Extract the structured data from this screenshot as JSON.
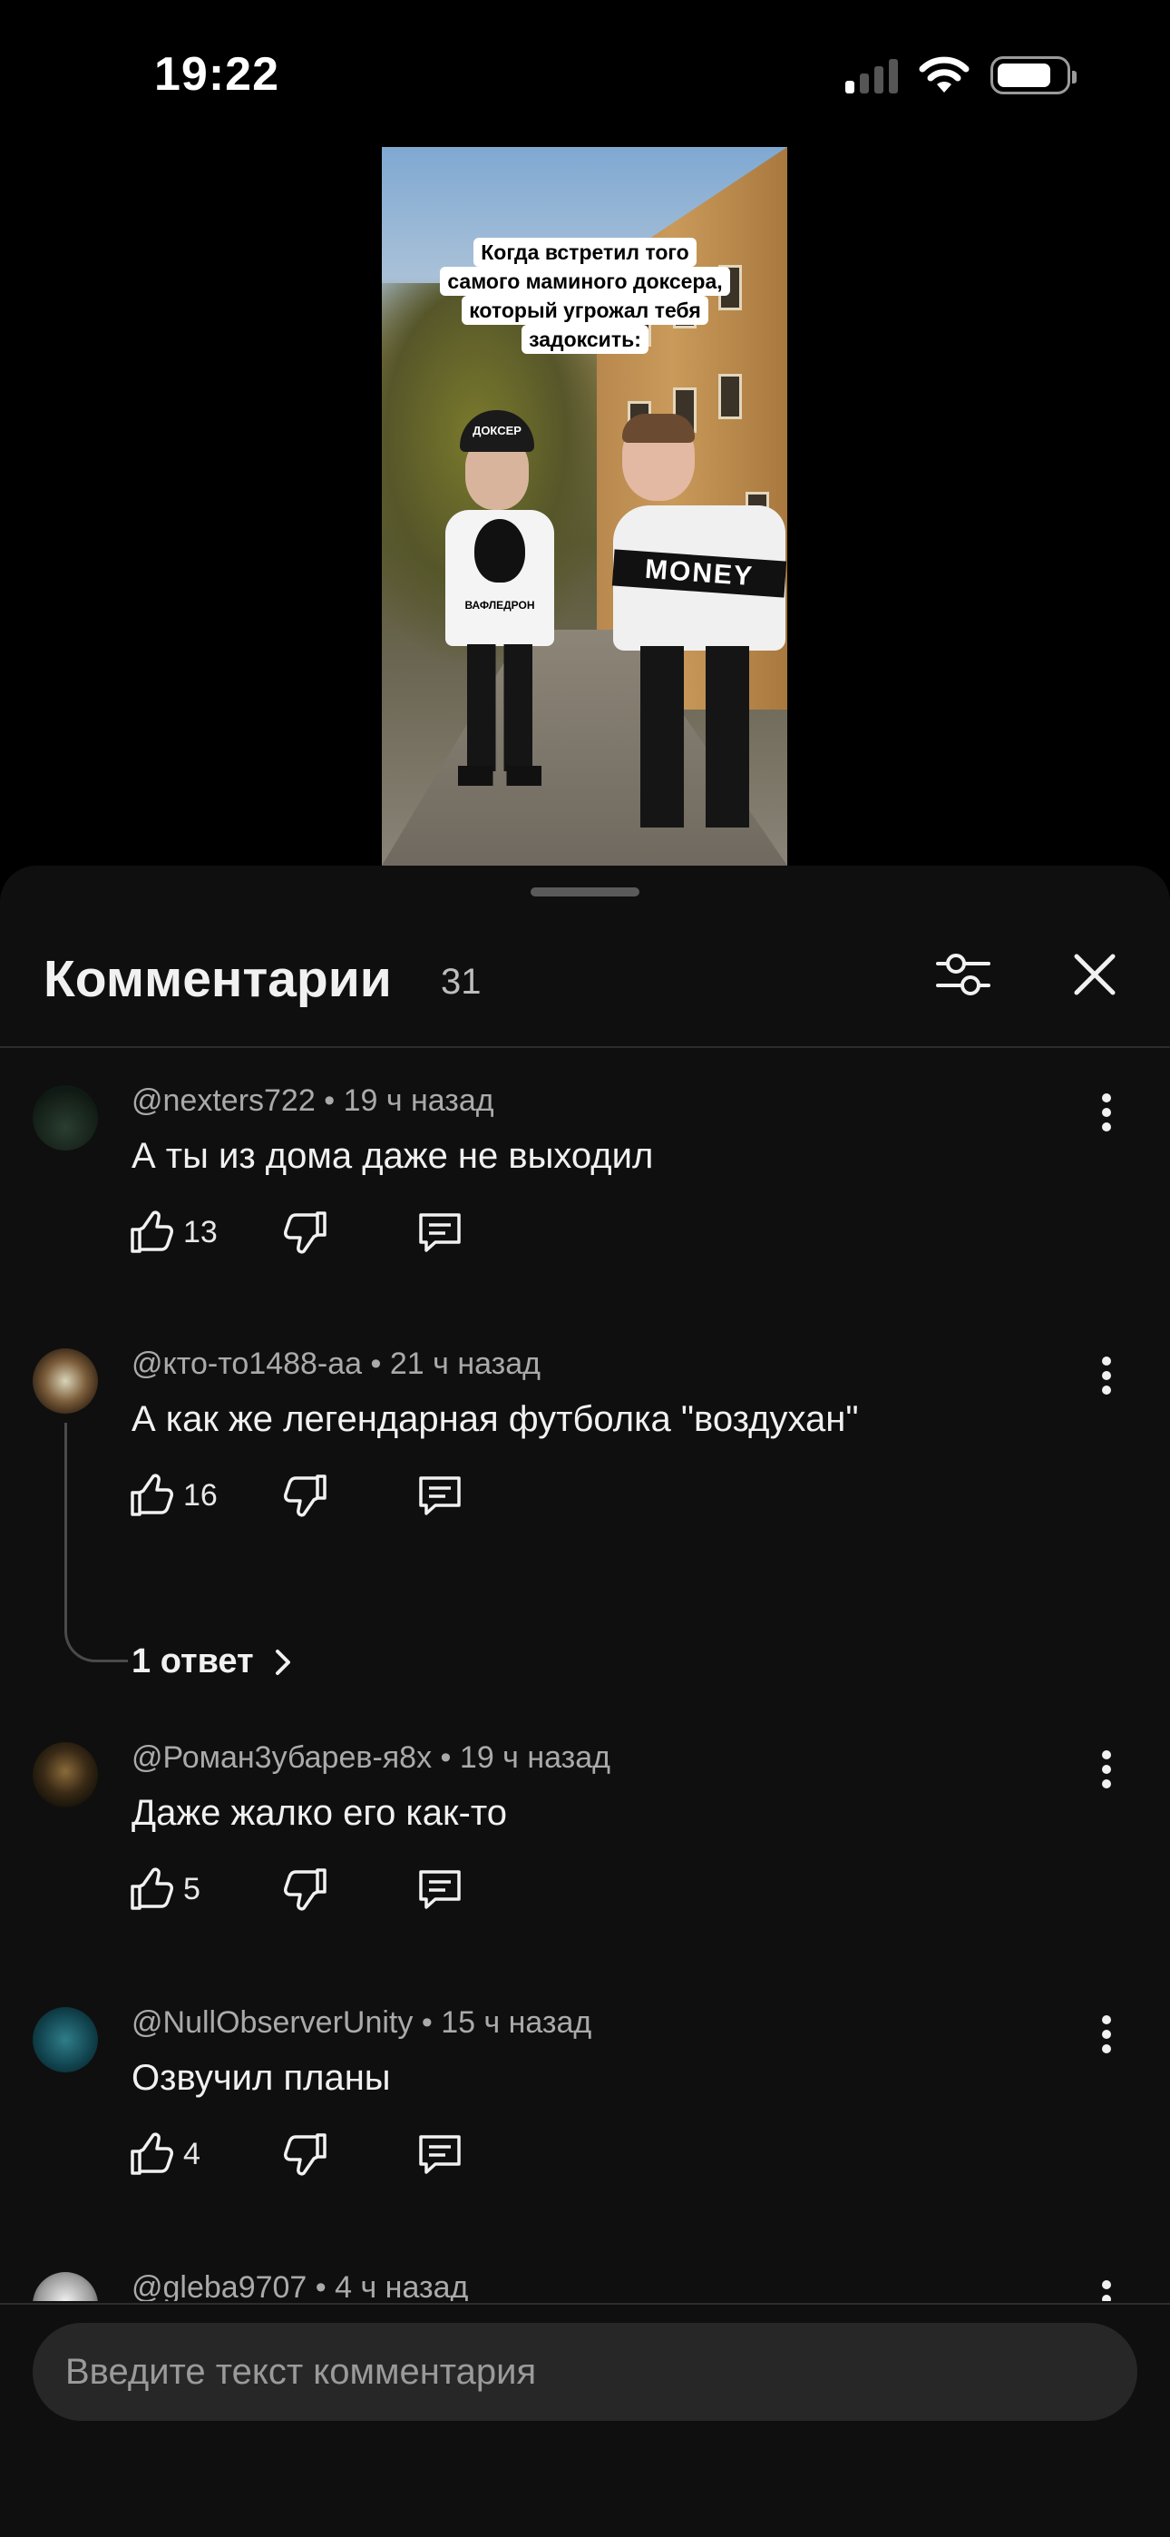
{
  "status_bar": {
    "time": "19:22"
  },
  "video": {
    "caption_lines": [
      "Когда встретил того",
      "самого маминого доксера,",
      "который угрожал тебя",
      "задоксить:"
    ],
    "cap_text": "ДОКСЕР",
    "shirt_left_text": "ВАФЛЕДРОН",
    "shirt_right_text": "MONEY"
  },
  "sheet": {
    "title": "Комментарии",
    "count": "31"
  },
  "comments": [
    {
      "author": "@nexters722",
      "time": "19 ч назад",
      "text": "А ты из дома даже не выходил",
      "likes": "13",
      "avatar_color": "#1c2a22"
    },
    {
      "author": "@кто-то1488-аа",
      "time": "21 ч назад",
      "text": "А как же легендарная футболка \"воздухан\"",
      "likes": "16",
      "replies_label": "1 ответ",
      "avatar_color": "#3a2a1a"
    },
    {
      "author": "@Роман3убарев-я8х",
      "time": "19 ч назад",
      "text": "Даже жалко его как-то",
      "likes": "5",
      "avatar_color": "#1e1a14"
    },
    {
      "author": "@NullObserverUnity",
      "time": "15 ч назад",
      "text": "Озвучил планы",
      "likes": "4",
      "avatar_color": "#0f3a44"
    },
    {
      "author": "@gleba9707",
      "time": "4 ч назад",
      "avatar_color": "#d8d8d8"
    }
  ],
  "input": {
    "placeholder": "Введите текст комментария"
  },
  "colors": {
    "background": "#000000",
    "sheet": "#0f0f0f",
    "input_bg": "#272727",
    "meta_text": "#aaaaaa"
  }
}
